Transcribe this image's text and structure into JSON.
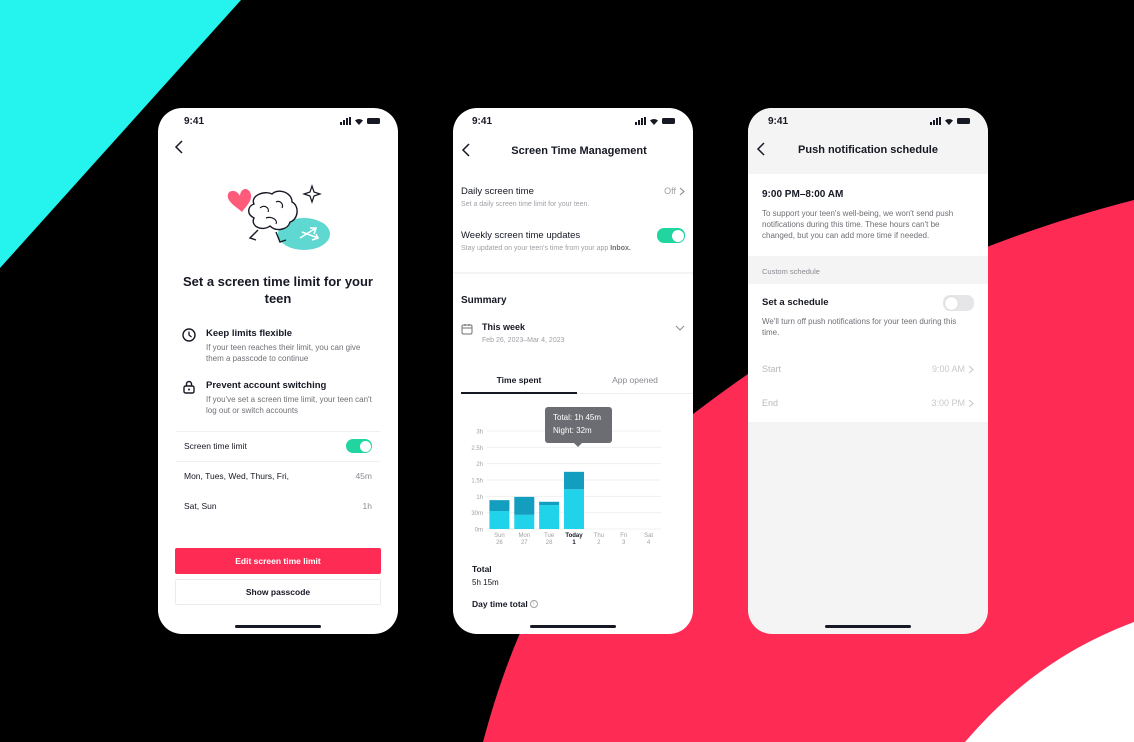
{
  "colors": {
    "cyan": "#25f4ee",
    "brand_red": "#fe2c55",
    "toggle_on": "#20d5a0",
    "bar_day": "#20d3ea",
    "bar_night": "#139ec0"
  },
  "status_bar": {
    "time": "9:41"
  },
  "screen1": {
    "title": "Set a screen time limit for your teen",
    "features": [
      {
        "icon": "clock-icon",
        "title": "Keep limits flexible",
        "desc": "If your teen reaches their limit, you can give them a passcode to continue"
      },
      {
        "icon": "lock-icon",
        "title": "Prevent account switching",
        "desc": "If you've set a screen time limit, your teen can't log out or switch accounts"
      }
    ],
    "screen_time_limit": {
      "label": "Screen time limit",
      "enabled": true
    },
    "limits": [
      {
        "days": "Mon, Tues, Wed, Thurs, Fri,",
        "value": "45m"
      },
      {
        "days": "Sat, Sun",
        "value": "1h"
      }
    ],
    "edit_button": "Edit screen time limit",
    "passcode_button": "Show passcode"
  },
  "screen2": {
    "title": "Screen Time Management",
    "daily": {
      "title": "Daily screen time",
      "desc": "Set a daily screen time limit for your teen.",
      "value": "Off"
    },
    "weekly": {
      "title": "Weekly screen time updates",
      "desc_prefix": "Stay updated on your teen's time from your app ",
      "desc_link": "Inbox.",
      "enabled": true
    },
    "summary_title": "Summary",
    "week": {
      "label": "This week",
      "range": "Feb 26, 2023–Mar 4, 2023"
    },
    "tabs": [
      {
        "label": "Time spent",
        "active": true
      },
      {
        "label": "App opened",
        "active": false
      }
    ],
    "tooltip": {
      "line1": "Total: 1h 45m",
      "line2": "Night: 32m"
    },
    "total_label": "Total",
    "total_value": "5h 15m",
    "daytime_total_label": "Day time total"
  },
  "chart_data": {
    "type": "bar",
    "stacked": true,
    "categories": [
      "Sun",
      "Mon",
      "Tue",
      "Today",
      "Thu",
      "Fri",
      "Sat"
    ],
    "dates": [
      "26",
      "27",
      "28",
      "1",
      "2",
      "3",
      "4"
    ],
    "highlight_index": 3,
    "series": [
      {
        "name": "Day",
        "values_minutes": [
          33,
          26,
          44,
          73,
          0,
          0,
          0
        ]
      },
      {
        "name": "Night",
        "values_minutes": [
          20,
          33,
          6,
          32,
          0,
          0,
          0
        ]
      }
    ],
    "y_ticks": [
      "0m",
      "30m",
      "1h",
      "1.5h",
      "2h",
      "2.5h",
      "3h"
    ],
    "ylim_minutes": [
      0,
      180
    ],
    "grid": true
  },
  "screen3": {
    "title": "Push notification schedule",
    "quiet_hours": "9:00 PM–8:00 AM",
    "quiet_desc": "To support your teen's well-being, we won't send push notifications during this time. These hours can't be changed, but you can add more time if needed.",
    "section_label": "Custom schedule",
    "schedule": {
      "title": "Set a schedule",
      "desc": "We'll turn off push notifications for your teen during this time.",
      "enabled": false
    },
    "start": {
      "label": "Start",
      "value": "9:00 AM"
    },
    "end": {
      "label": "End",
      "value": "3:00 PM"
    }
  }
}
